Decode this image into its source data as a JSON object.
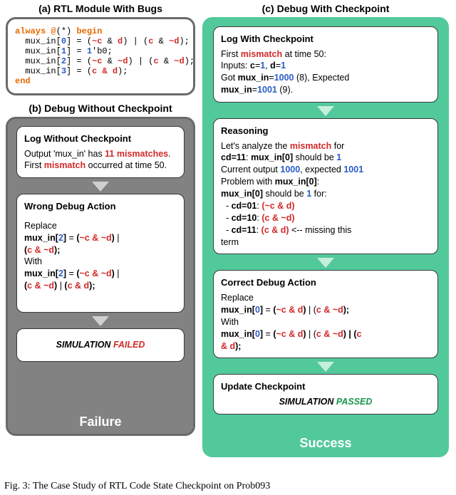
{
  "labels": {
    "a": "(a) RTL Module With Bugs",
    "b": "(b) Debug Without Checkpoint",
    "c": "(c) Debug With Checkpoint",
    "failure": "Failure",
    "success": "Success"
  },
  "panel_a": {
    "code_lines": [
      {
        "pre": "always @(*) begin",
        "kw": true
      },
      {
        "pre": "  mux_in[",
        "idx": "0",
        "post1": "] = (",
        "expr": [
          [
            "~c",
            "op"
          ],
          [
            " & ",
            ""
          ],
          [
            "d",
            "op"
          ]
        ],
        "post2": ") | (",
        "expr2": [
          [
            "c",
            "op"
          ],
          [
            " & ",
            ""
          ],
          [
            "~d",
            "op"
          ]
        ],
        "post3": ");",
        "indent": true
      },
      {
        "pre": "  mux_in[",
        "idx": "1",
        "post1": "] = ",
        "lit": "1",
        "lit2": "'b0;",
        "indent": true
      },
      {
        "pre": "  mux_in[",
        "idx": "2",
        "post1": "] = (",
        "expr": [
          [
            "~c",
            "op"
          ],
          [
            " & ",
            ""
          ],
          [
            "~d",
            "op"
          ]
        ],
        "post2": ") | (",
        "expr2": [
          [
            "c",
            "op"
          ],
          [
            " & ",
            ""
          ],
          [
            "~d",
            "op"
          ]
        ],
        "post3": ");",
        "indent": true
      },
      {
        "pre": "  mux_in[",
        "idx": "3",
        "post1": "] = (",
        "expr": [
          [
            "c",
            "op"
          ],
          [
            " ",
            ""
          ],
          [
            "& d",
            "op"
          ]
        ],
        "post2": ");",
        "indent": true
      },
      {
        "pre": "end",
        "kw": true
      }
    ]
  },
  "panel_b": {
    "log": {
      "title": "Log Without Checkpoint",
      "l1a": "Output 'mux_in' has ",
      "l1b": "11 mismatches",
      "l1c": ". First ",
      "l2a": "mismatch",
      "l2b": " occurred at time 50."
    },
    "wrong": {
      "title": "Wrong Debug Action",
      "replace": "Replace",
      "r1_a": "mux_in[",
      "r1_idx": "2",
      "r1_b": "]",
      "r1_c": " = ",
      "r1_d": "(",
      "r1_e": "~c & ~d",
      "r1_f": ")",
      "r1_g": " | ",
      "r2_a": "(",
      "r2_b": "c & ~d",
      "r2_c": ");",
      "with": "With",
      "w1_a": "mux_in[",
      "w1_idx": "2",
      "w1_b": "]",
      "w1_c": " = ",
      "w1_d": "(",
      "w1_e": "~c & ~d",
      "w1_f": ")",
      "w1_g": " | ",
      "w2_a": "(",
      "w2_b": "c & ~d",
      "w2_c": ")",
      "w2_d": " | ",
      "w2_e": "(",
      "w2_f": "c & d",
      "w2_g": ");"
    },
    "result": {
      "sim": "SIMULATION ",
      "status": "FAILED"
    }
  },
  "panel_c": {
    "log": {
      "title": "Log With Checkpoint",
      "l1a": "First ",
      "l1b": "mismatch",
      "l1c": " at time 50:",
      "l2a": "Inputs: ",
      "l2b": "c",
      "l2c": "=",
      "l2d": "1",
      "l2e": ", ",
      "l2f": "d",
      "l2g": "=",
      "l2h": "1",
      "l3a": "Got ",
      "l3b": "mux_in",
      "l3c": "=",
      "l3d": "1000",
      "l3e": " (8), Expected",
      "l4a": "mux_in",
      "l4b": "=",
      "l4c": "1001",
      "l4d": " (9)."
    },
    "reason": {
      "title": "Reasoning",
      "r1a": "Let's analyze the ",
      "r1b": "mismatch",
      "r1c": " for",
      "r2a": "cd=11",
      "r2b": ": ",
      "r2c": "mux_in[0]",
      "r2d": " should be ",
      "r2e": "1",
      "r3a": "Current output ",
      "r3b": "1000",
      "r3c": ", expected ",
      "r3d": "1001",
      "r4a": "Problem with ",
      "r4b": "mux_in[0]",
      "r4c": ":",
      "r5a": "mux_in[0]",
      "r5b": " should be ",
      "r5c": "1",
      "r5d": " for:",
      "li1a": "  - ",
      "li1b": "cd=01",
      "li1c": ": ",
      "li1d": "(~c & d)",
      "li2a": "  - ",
      "li2b": "cd=10",
      "li2c": ": ",
      "li2d": "(c & ~d)",
      "li3a": "  - ",
      "li3b": "cd=11",
      "li3c": ": ",
      "li3d": "(c & d)",
      "li3e": " <-- missing this",
      "tail": "term"
    },
    "correct": {
      "title": "Correct Debug Action",
      "replace": "Replace",
      "r1_a": "mux_in[",
      "r1_idx": "0",
      "r1_b": "]",
      "r1_c": " = ",
      "r1_d": "(",
      "r1_e": "~c & d",
      "r1_f": ")",
      "r1_g": " | (",
      "r1_h": "c & ~d",
      "r1_i": ");",
      "with": "With",
      "w1_a": "mux_in[",
      "w1_idx": "0",
      "w1_b": "]",
      "w1_c": " = ",
      "w1_d": "(",
      "w1_e": "~c & d",
      "w1_f": ")",
      "w1_g": " | (",
      "w1_h": "c & ~d",
      "w1_i": ") | (",
      "w1_j": "c",
      "w2_a": "& d",
      "w2_b": ");"
    },
    "update": {
      "title": "Update Checkpoint",
      "sim": "SIMULATION ",
      "status": "PASSED"
    }
  },
  "caption": "Fig. 3: The Case Study of RTL Code State Checkpoint on Prob093"
}
